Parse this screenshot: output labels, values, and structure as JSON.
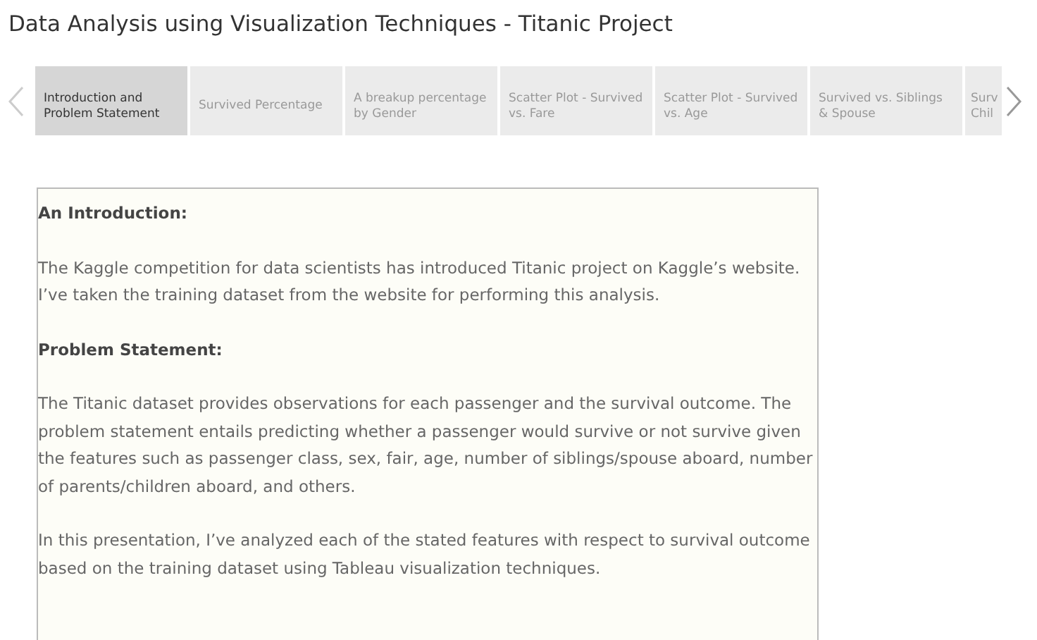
{
  "title": "Data Analysis using Visualization Techniques - Titanic Project",
  "tabs": [
    {
      "label": "Introduction and Problem Statement",
      "selected": true
    },
    {
      "label": "Survived Percentage",
      "selected": false
    },
    {
      "label": "A breakup percentage by Gender",
      "selected": false
    },
    {
      "label": "Scatter Plot - Survived vs. Fare",
      "selected": false
    },
    {
      "label": "Scatter Plot - Survived vs. Age",
      "selected": false
    },
    {
      "label": "Survived vs. Siblings & Spouse",
      "selected": false
    },
    {
      "label": "Surv Chil",
      "selected": false
    }
  ],
  "content": [
    {
      "kind": "heading",
      "text": "An Introduction:"
    },
    {
      "kind": "paragraph",
      "text": "The Kaggle competition for data scientists has introduced Titanic project on Kaggle’s website. I’ve taken the training dataset from the website for performing this analysis."
    },
    {
      "kind": "heading",
      "text": "Problem Statement:"
    },
    {
      "kind": "paragraph",
      "text": "The Titanic dataset provides observations for each passenger and the survival outcome. The problem statement entails predicting whether a passenger would survive or not survive given the features such as passenger class, sex, fair, age, number of siblings/spouse aboard, number of parents/children aboard, and others."
    },
    {
      "kind": "paragraph",
      "text": "In this presentation, I’ve analyzed each of the stated features with respect to survival outcome based on the training dataset using Tableau visualization techniques."
    }
  ]
}
